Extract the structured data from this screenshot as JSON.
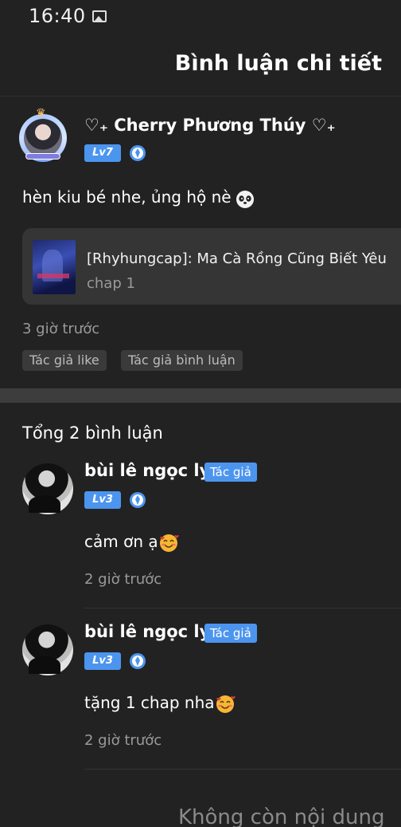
{
  "status_bar": {
    "time": "16:40",
    "icon": "image-icon"
  },
  "header": {
    "title": "Bình luận chi tiết"
  },
  "post": {
    "author": "♡₊ Cherry Phương Thúy ♡₊",
    "level": "Lv7",
    "text": "hèn kiu bé nhe, ủng hộ nè",
    "emoji": "panda-face-icon",
    "story": {
      "title": "[Rhyhungcap]: Ma Cà Rồng Cũng Biết Yêu",
      "chapter": "chap 1"
    },
    "time": "3 giờ trước",
    "tags": [
      "Tác giả like",
      "Tác giả bình luận"
    ]
  },
  "comments_section": {
    "header": "Tổng 2 bình luận",
    "comments": [
      {
        "author": "bùi lê ngọc ly",
        "badge": "Tác giả",
        "level": "Lv3",
        "text": "cảm ơn ạ",
        "emoji": "smiling-face-with-hearts-icon",
        "time": "2 giờ trước"
      },
      {
        "author": "bùi lê ngọc ly",
        "badge": "Tác giả",
        "level": "Lv3",
        "text": "tặng 1 chap nha",
        "emoji": "smiling-face-with-hearts-icon",
        "time": "2 giờ trước"
      }
    ]
  },
  "footer": {
    "end_text": "Không còn nội dung"
  },
  "colors": {
    "background": "#222222",
    "accent": "#4c95ef",
    "muted_text": "#9a9a9a",
    "card": "#353535"
  }
}
